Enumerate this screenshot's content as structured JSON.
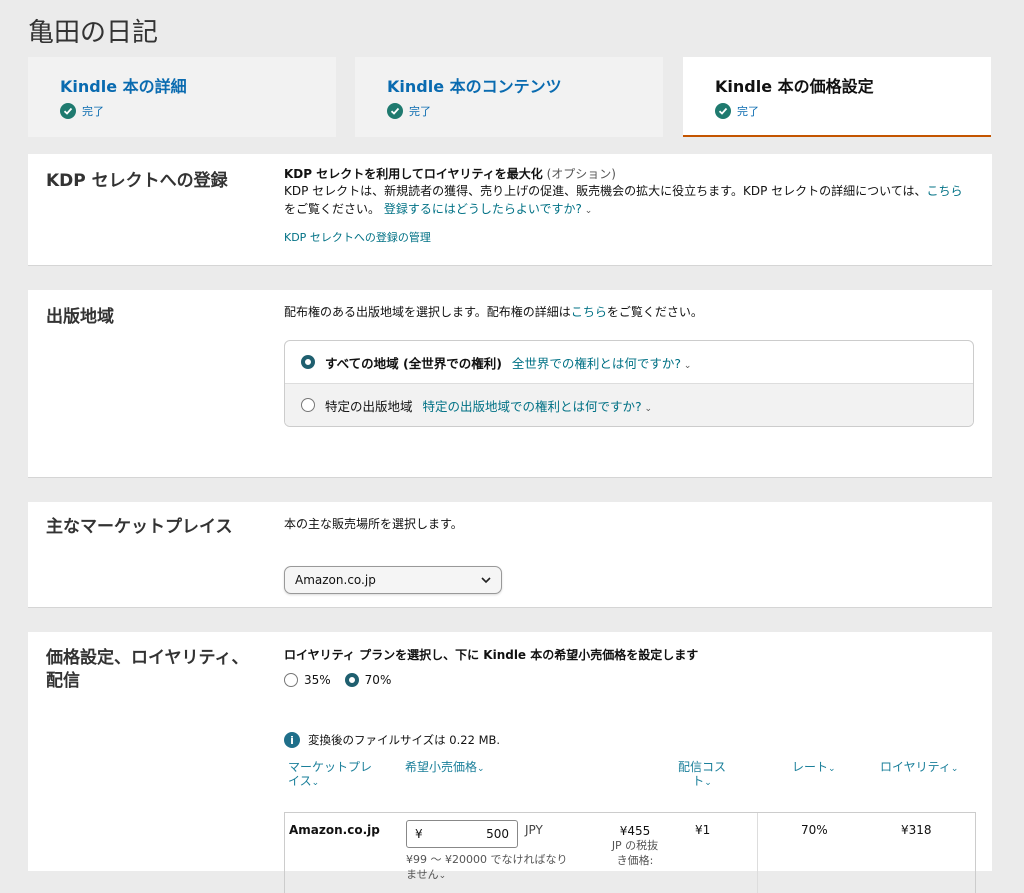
{
  "page_title": "亀田の日記",
  "steps": [
    {
      "title": "Kindle 本の詳細",
      "status": "完了"
    },
    {
      "title": "Kindle 本のコンテンツ",
      "status": "完了"
    },
    {
      "title": "Kindle 本の価格設定",
      "status": "完了"
    }
  ],
  "kdp_select": {
    "title": "KDP セレクトへの登録",
    "heading": "KDP セレクトを利用してロイヤリティを最大化",
    "optional": "(オプション)",
    "desc": "KDP セレクトは、新規読者の獲得、売り上げの促進、販売機会の拡大に役立ちます。KDP セレクトの詳細については、",
    "here_link": "こちら",
    "see_text": "をご覧ください。",
    "how_link": "登録するにはどうしたらよいですか?",
    "manage_link": "KDP セレクトへの登録の管理"
  },
  "territory": {
    "title": "出版地域",
    "desc_prefix": "配布権のある出版地域を選択します。配布権の詳細は",
    "here_link": "こちら",
    "desc_suffix": "をご覧ください。",
    "options": [
      {
        "label": "すべての地域 (全世界での権利)",
        "help": "全世界での権利とは何ですか?",
        "selected": true
      },
      {
        "label": "特定の出版地域",
        "help": "特定の出版地域での権利とは何ですか?",
        "selected": false
      }
    ]
  },
  "marketplace": {
    "title": "主なマーケットプレイス",
    "desc": "本の主な販売場所を選択します。",
    "selected": "Amazon.co.jp"
  },
  "pricing": {
    "title_line1": "価格設定、ロイヤリティ、",
    "title_line2": "配信",
    "heading": "ロイヤリティ プランを選択し、下に Kindle 本の希望小売価格を設定します",
    "plans": [
      {
        "label": "35%",
        "selected": false
      },
      {
        "label": "70%",
        "selected": true
      }
    ],
    "file_size_note": "変換後のファイルサイズは 0.22 MB.",
    "columns": {
      "marketplace_1": "マーケットプレ",
      "marketplace_2": "イス",
      "list_price": "希望小売価格",
      "delivery_1": "配信コス",
      "delivery_2": "ト",
      "rate": "レート",
      "royalty": "ロイヤリティ"
    },
    "row": {
      "marketplace": "Amazon.co.jp",
      "currency_symbol": "¥",
      "price": "500",
      "currency": "JPY",
      "range_1": "¥99 ～ ¥20000 でなければなり",
      "range_2": "ません",
      "tax_excl_price": "¥455",
      "tax_note_1": "JP の税抜",
      "tax_note_2": "き価格:",
      "delivery_cost": "¥1",
      "rate": "70%",
      "royalty": "¥318"
    }
  },
  "colors": {
    "accent": "#1f5f6f",
    "link": "#007185",
    "active_tab_border": "#c45500"
  }
}
